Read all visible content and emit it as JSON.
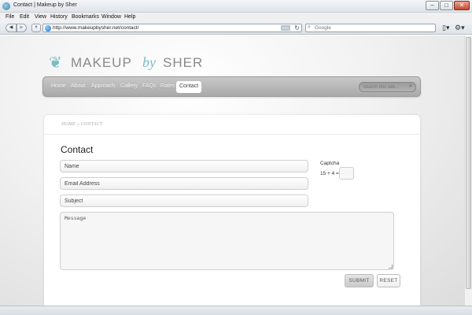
{
  "window": {
    "title": "Contact | Makeup by Sher",
    "minimize_glyph": "–",
    "maximize_glyph": "□",
    "close_glyph": "✕"
  },
  "menu": {
    "items": [
      "File",
      "Edit",
      "View",
      "History",
      "Bookmarks",
      "Window",
      "Help"
    ]
  },
  "toolbar": {
    "back_glyph": "◀",
    "forward_glyph": "▶",
    "add_glyph": "+",
    "url": "http://www.makeupbysher.net/contact/",
    "rss_label": "RSS",
    "reload_glyph": "↻",
    "search_placeholder": "Google",
    "search_glyph": "⌕",
    "page_glyph": "▯▾",
    "gear_glyph": "⚙▾"
  },
  "site": {
    "logo": {
      "part1": "MAKEUP",
      "part2": "by",
      "part3": "SHER",
      "emblem_glyph": "❦",
      "brand_color": "#7bbcc3"
    },
    "nav": {
      "items": [
        "Home",
        "About",
        "Approach",
        "Gallery",
        "FAQs",
        "Rates",
        "Contact"
      ],
      "active": "Contact",
      "search_placeholder": "search this site...",
      "search_glyph": "⌕"
    }
  },
  "content": {
    "breadcrumb": "HOME » CONTACT",
    "title": "Contact",
    "form": {
      "name_placeholder": "Name",
      "email_placeholder": "Email Address",
      "subject_placeholder": "Subject",
      "message_placeholder": "Message",
      "captcha_label": "Captcha",
      "captcha_question": "15 + 4 =",
      "submit_label": "SUBMIT",
      "reset_label": "RESET"
    }
  }
}
